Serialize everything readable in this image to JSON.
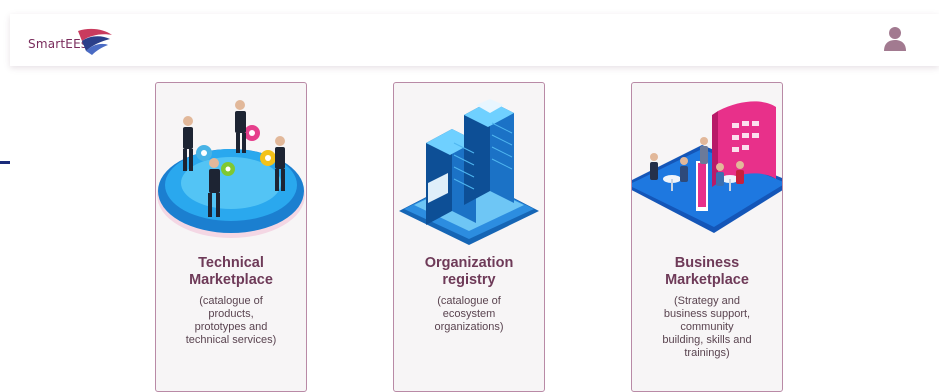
{
  "header": {
    "logo_text": "SmartEEs",
    "user_icon": "user-icon"
  },
  "cards": [
    {
      "title_line1": "Technical",
      "title_line2": "Marketplace",
      "desc": [
        "(catalogue of",
        "products,",
        "prototypes and",
        "technical services)"
      ],
      "illustration": "people-gears-platform-illustration"
    },
    {
      "title_line1": "Organization",
      "title_line2": "registry",
      "desc": [
        "(catalogue of",
        "ecosystem",
        "organizations)"
      ],
      "illustration": "server-racks-illustration"
    },
    {
      "title_line1": "Business",
      "title_line2": "Marketplace",
      "desc": [
        "(Strategy and",
        "business support,",
        "community",
        "building, skills and",
        "trainings)"
      ],
      "illustration": "exhibition-booth-illustration"
    }
  ],
  "colors": {
    "title": "#6e3a58",
    "card_border": "#b98aa6",
    "brand": "#7a2c5c",
    "user_icon": "#a27a90"
  }
}
